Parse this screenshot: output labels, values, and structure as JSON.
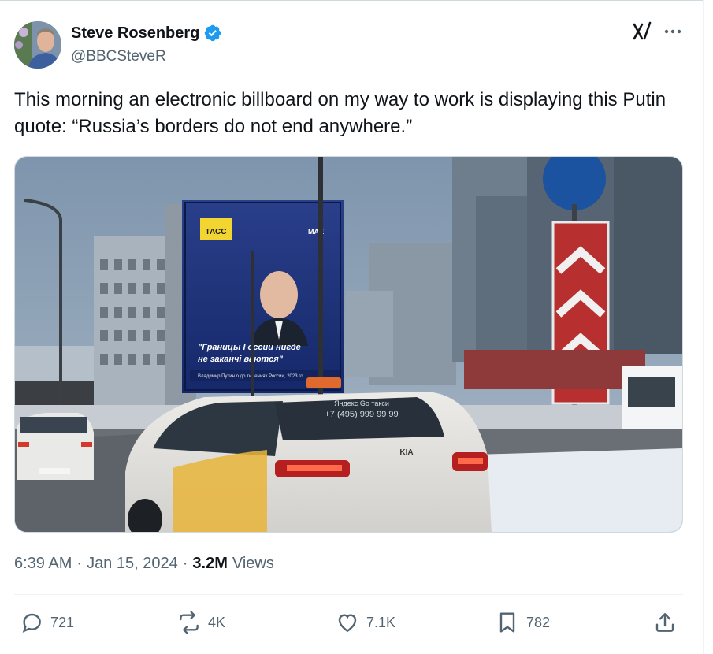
{
  "author": {
    "display_name": "Steve Rosenberg",
    "handle": "@BBCSteveR",
    "verified": true
  },
  "tweet": {
    "text": "This morning an electronic billboard on my way to work is displaying this Putin quote: “Russia’s borders do not end anywhere.”"
  },
  "media": {
    "billboard": {
      "brand_logo": "ТАСС",
      "corner_logo": "МАЕ",
      "quote_line1": "\"Границы I оссии нигде",
      "quote_line2": "не заканчі ваются\"",
      "caption": "Владимир Путин о до тижениях России, 2023 го"
    },
    "taxi": {
      "phone": "+7 (495) 999 99 99",
      "service": "Яндекс Go такси",
      "car_brand": "KIA"
    }
  },
  "meta": {
    "time": "6:39 AM",
    "separator": "·",
    "date": "Jan 15, 2024",
    "views_count": "3.2M",
    "views_label": "Views"
  },
  "actions": {
    "replies": "721",
    "reposts": "4K",
    "likes": "7.1K",
    "bookmarks": "782"
  },
  "colors": {
    "accent_blue": "#1d9bf0",
    "text": "#0f1419",
    "muted": "#536471"
  }
}
